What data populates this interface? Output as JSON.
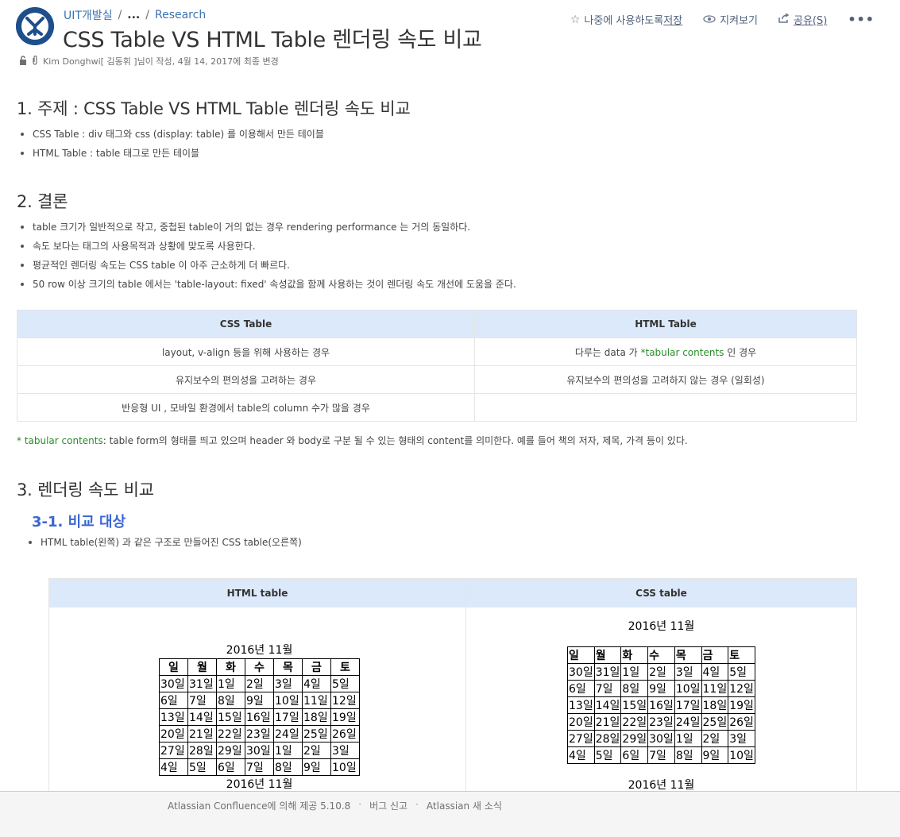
{
  "header": {
    "breadcrumb": [
      "UIT개발실",
      "...",
      "Research"
    ],
    "title": "CSS Table VS HTML Table 렌더링 속도 비교",
    "byline": "Kim Donghwi[ 김동휘 ]님이 작성, 4월 14, 2017에 최종 변경"
  },
  "actions": {
    "save_prefix": "나중에 사용하도록 ",
    "save_label": "저장",
    "watch_label": "지켜보기",
    "share_label": "공유(S)",
    "more_label": "•••"
  },
  "sections": {
    "s1": {
      "title": "1. 주제 : CSS Table VS HTML Table 렌더링 속도 비교",
      "items": [
        "CSS Table : div 태그와 css (display: table) 를 이용해서 만든 테이블",
        "HTML Table : table 태그로 만든 테이블"
      ]
    },
    "s2": {
      "title": "2. 결론",
      "items": [
        "table 크기가 일반적으로 작고, 중첩된 table이 거의 없는 경우 rendering performance 는 거의 동일하다.",
        "속도 보다는 태그의 사용목적과 상황에 맞도록 사용한다.",
        "평균적인 렌더링 속도는 CSS table 이 아주 근소하게 더 빠르다.",
        "50 row 이상 크기의 table 에서는  'table-layout: fixed' 속성값을 함께 사용하는 것이 렌더링 속도 개선에 도움을 준다."
      ],
      "table": {
        "headers": [
          "CSS Table",
          "HTML Table"
        ],
        "rows": [
          [
            "layout, v-align 등을 위해 사용하는 경우",
            "다루는 data 가 ",
            "*tabular contents",
            " 인 경우"
          ],
          [
            "유지보수의 편의성을 고려하는 경우",
            "유지보수의 편의성을 고려하지 않는 경우 (일회성)"
          ],
          [
            "반응형 UI , 모바일 환경에서 table의 column 수가 많을 경우",
            ""
          ]
        ]
      },
      "footnote_term": "* tabular contents",
      "footnote_text": ": table form의 형태를 띄고 있으며 header 와 body로 구분 될 수 있는 형태의 content를 의미한다. 예를 들어 책의 저자, 제목, 가격 등이 있다."
    },
    "s3": {
      "title": "3. 렌더링 속도 비교",
      "sub_title": "3-1. 비교 대상",
      "items": [
        "HTML table(왼쪽) 과 같은 구조로 만들어진 CSS table(오른쪽)"
      ]
    }
  },
  "demo": {
    "headers": [
      "HTML table",
      "CSS table"
    ],
    "caption": "2016년 11월",
    "weekdays": [
      "일",
      "월",
      "화",
      "수",
      "목",
      "금",
      "토"
    ],
    "weeks": [
      [
        "30일",
        "31일",
        "1일",
        "2일",
        "3일",
        "4일",
        "5일"
      ],
      [
        "6일",
        "7일",
        "8일",
        "9일",
        "10일",
        "11일",
        "12일"
      ],
      [
        "13일",
        "14일",
        "15일",
        "16일",
        "17일",
        "18일",
        "19일"
      ],
      [
        "20일",
        "21일",
        "22일",
        "23일",
        "24일",
        "25일",
        "26일"
      ],
      [
        "27일",
        "28일",
        "29일",
        "30일",
        "1일",
        "2일",
        "3일"
      ],
      [
        "4일",
        "5일",
        "6일",
        "7일",
        "8일",
        "9일",
        "10일"
      ]
    ]
  },
  "footer": {
    "powered": "Atlassian Confluence에 의해 제공 5.10.8",
    "bug": "버그 신고",
    "news": "Atlassian 새 소식"
  }
}
